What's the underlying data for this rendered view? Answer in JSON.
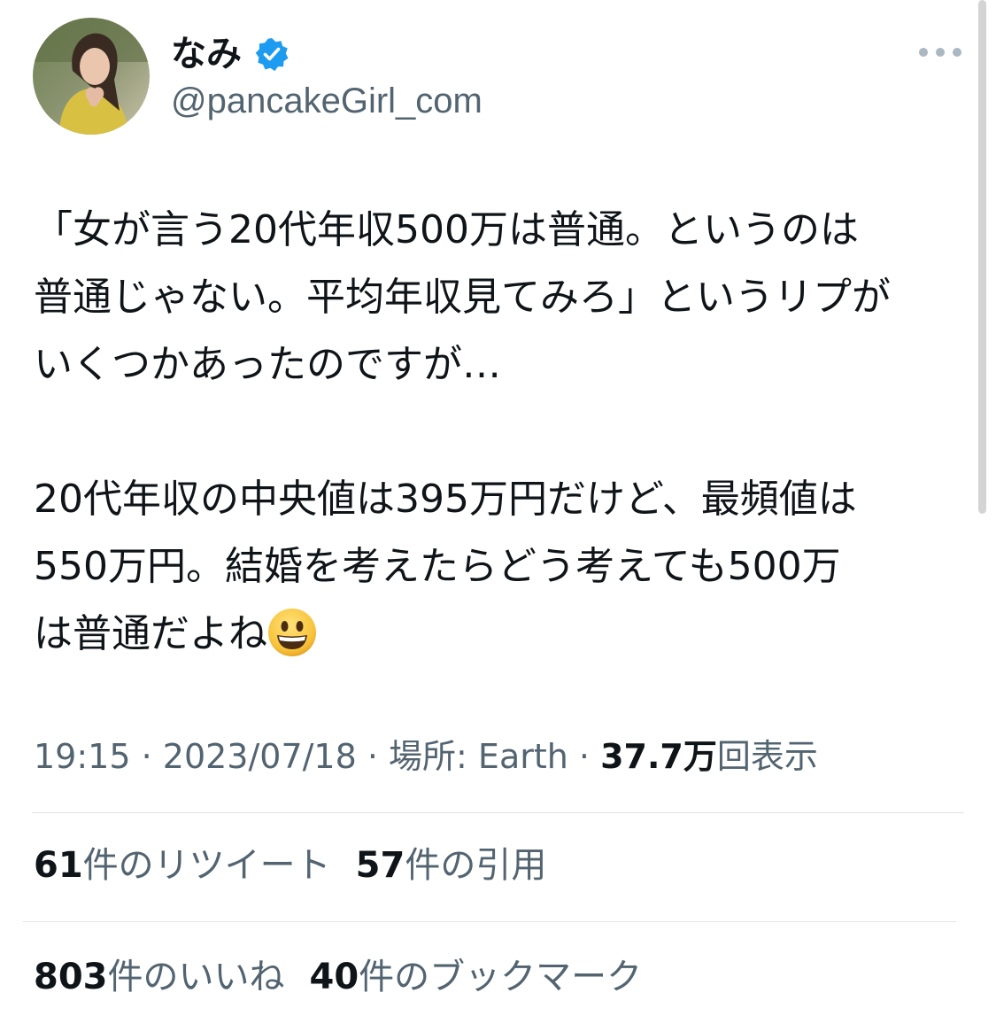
{
  "author": {
    "display_name": "なみ",
    "handle": "@pancakeGirl_com",
    "verified": true
  },
  "tweet": {
    "lines": [
      "「女が言う20代年収500万は普通。というのは",
      "普通じゃない。平均年収見てみろ」というリプが",
      "いくつかあったのですが…",
      "",
      "20代年収の中央値は395万円だけど、最頻値は",
      "550万円。結婚を考えたらどう考えても500万",
      "は普通だよね"
    ]
  },
  "meta": {
    "time": "19:15",
    "date": "2023/07/18",
    "location_label": "場所: Earth",
    "views_count": "37.7万",
    "views_label": "回表示",
    "separator": " · "
  },
  "stats": {
    "retweets_count": "61",
    "retweets_label": "件のリツイート",
    "quotes_count": "57",
    "quotes_label": "件の引用",
    "likes_count": "803",
    "likes_label": "件のいいね",
    "bookmarks_count": "40",
    "bookmarks_label": "件のブックマーク"
  },
  "colors": {
    "verified_blue": "#1d9bf0",
    "secondary_text": "#536471",
    "primary_text": "#0f1419"
  },
  "icons": {
    "more": "more-horizontal-icon",
    "verified": "verified-badge-icon",
    "emoji": "grinning-face-emoji"
  }
}
